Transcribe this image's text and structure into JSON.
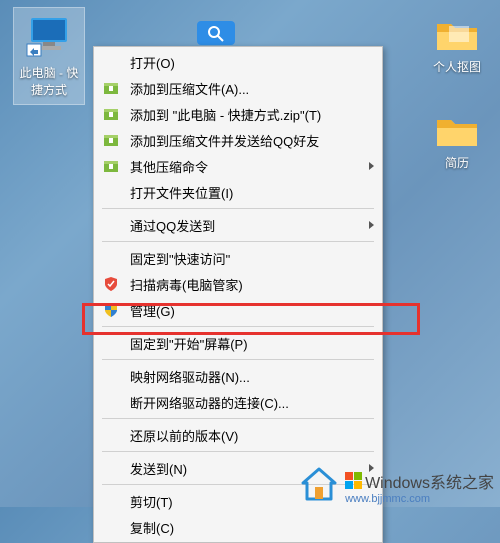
{
  "desktop": {
    "selected_icon_label": "此电脑 - 快捷方式",
    "right_icons": [
      {
        "label": "个人抠图"
      },
      {
        "label": "简历"
      }
    ]
  },
  "context_menu": [
    {
      "label": "打开(O)",
      "icon": "",
      "submenu": false
    },
    {
      "label": "添加到压缩文件(A)...",
      "icon": "archive",
      "submenu": false
    },
    {
      "label": "添加到 \"此电脑 - 快捷方式.zip\"(T)",
      "icon": "archive",
      "submenu": false
    },
    {
      "label": "添加到压缩文件并发送给QQ好友",
      "icon": "archive",
      "submenu": false
    },
    {
      "label": "其他压缩命令",
      "icon": "archive",
      "submenu": true
    },
    {
      "label": "打开文件夹位置(I)",
      "icon": "",
      "submenu": false
    },
    {
      "sep": true
    },
    {
      "label": "通过QQ发送到",
      "icon": "",
      "submenu": true
    },
    {
      "sep": true
    },
    {
      "label": "固定到\"快速访问\"",
      "icon": "",
      "submenu": false
    },
    {
      "label": "扫描病毒(电脑管家)",
      "icon": "shield-red",
      "submenu": false
    },
    {
      "label": "管理(G)",
      "icon": "shield-uac",
      "submenu": false
    },
    {
      "sep": true
    },
    {
      "label": "固定到\"开始\"屏幕(P)",
      "icon": "",
      "submenu": false
    },
    {
      "sep": true
    },
    {
      "label": "映射网络驱动器(N)...",
      "icon": "",
      "submenu": false
    },
    {
      "label": "断开网络驱动器的连接(C)...",
      "icon": "",
      "submenu": false
    },
    {
      "sep": true
    },
    {
      "label": "还原以前的版本(V)",
      "icon": "",
      "submenu": false
    },
    {
      "sep": true
    },
    {
      "label": "发送到(N)",
      "icon": "",
      "submenu": true
    },
    {
      "sep": true
    },
    {
      "label": "剪切(T)",
      "icon": "",
      "submenu": false
    },
    {
      "label": "复制(C)",
      "icon": "",
      "submenu": false
    }
  ],
  "watermark": {
    "title": "Windows系统之家",
    "url": "www.bjjmmc.com"
  }
}
